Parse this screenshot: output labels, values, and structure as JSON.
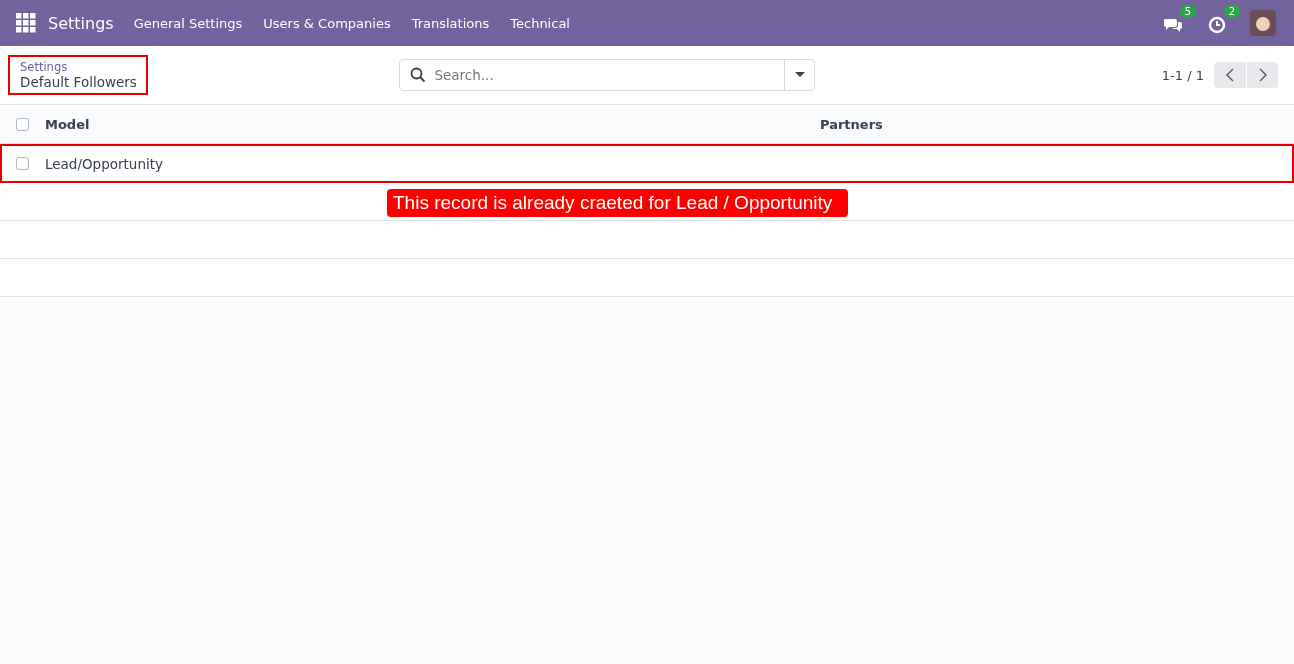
{
  "navbar": {
    "app_name": "Settings",
    "menu": [
      "General Settings",
      "Users & Companies",
      "Translations",
      "Technical"
    ],
    "messages_count": "5",
    "activities_count": "2"
  },
  "breadcrumb": {
    "parent": "Settings",
    "current": "Default Followers",
    "highlighted": true
  },
  "search": {
    "placeholder": "Search..."
  },
  "pager": {
    "range": "1-1 / 1"
  },
  "table": {
    "columns": [
      "Model",
      "Partners"
    ],
    "all_checked": false,
    "rows": [
      {
        "model": "Lead/Opportunity",
        "checked": false,
        "highlighted": true
      }
    ]
  },
  "callout": {
    "text": "This record is already craeted for Lead / Opportunity"
  }
}
